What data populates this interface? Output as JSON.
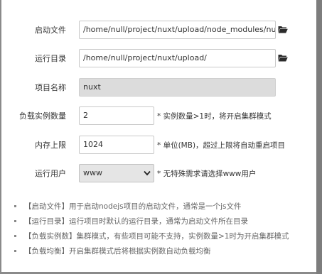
{
  "form": {
    "startup_file": {
      "label": "启动文件",
      "value": "/home/null/project/nuxt/upload/node_modules/nuxt/bin/nu"
    },
    "run_dir": {
      "label": "运行目录",
      "value": "/home/null/project/nuxt/upload/"
    },
    "project_name": {
      "label": "项目名称",
      "value": "nuxt"
    },
    "instances": {
      "label": "负载实例数量",
      "value": "2",
      "hint": "* 实例数量>1时，将开启集群模式"
    },
    "memory_limit": {
      "label": "内存上限",
      "value": "1024",
      "hint": "* 单位(MB)，超过上限将自动重启项目"
    },
    "run_user": {
      "label": "运行用户",
      "value": "www",
      "hint": "* 无特殊需求请选择www用户"
    }
  },
  "notes": [
    "【启动文件】用于启动nodejs项目的启动文件，通常是一个js文件",
    "【运行目录】运行项目时默认的运行目录，通常为启动文件所在目录",
    "【负载实例数】集群模式，有些项目可能不支持，实例数量>1时为开启集群模式",
    "【负载均衡】开启集群模式后将根据实例数自动负载均衡"
  ],
  "icons": {
    "folder": "folder-open-icon",
    "select_arrow": "chevron-down-icon"
  },
  "colors": {
    "folder_icon": "#2b2b2b",
    "readonly_bg": "#dcdcdc",
    "backdrop": "#8a8a8a"
  }
}
